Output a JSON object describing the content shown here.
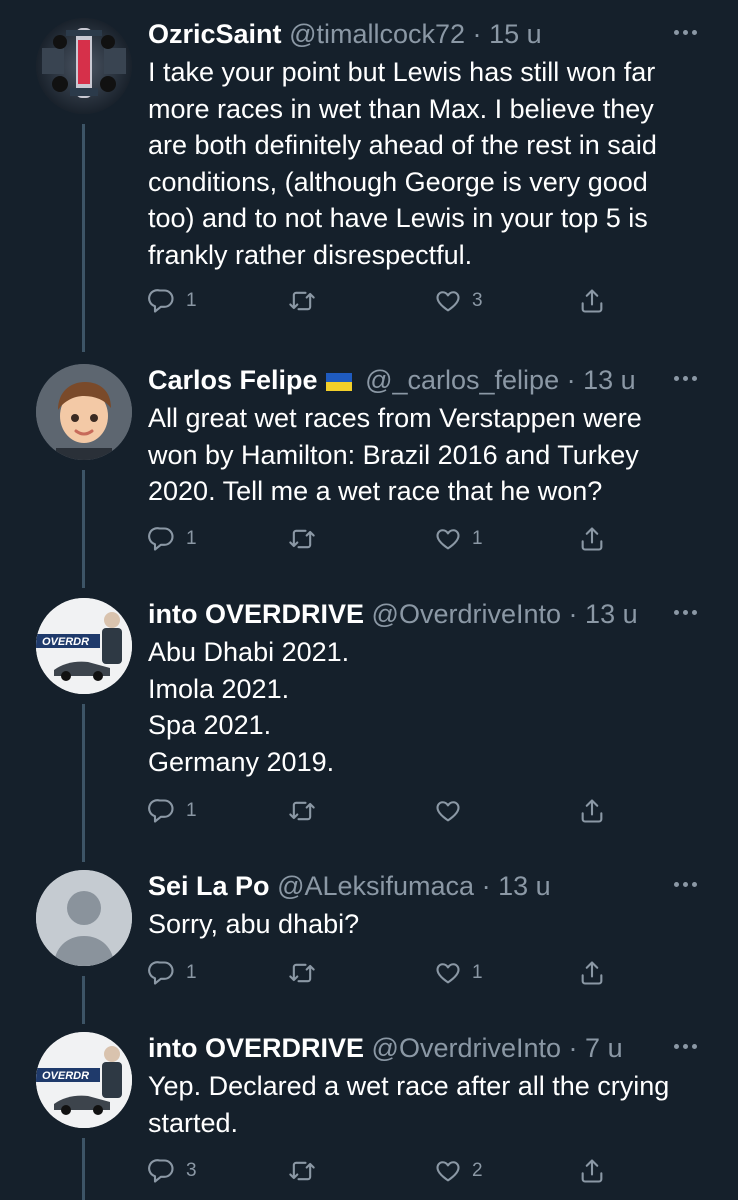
{
  "tweets": [
    {
      "name": "OzricSaint",
      "handle": "@timallcock72",
      "separator": "·",
      "time": "15 u",
      "lines": [
        "I take your point but Lewis has still won far",
        "more races in wet than Max. I believe they",
        "are both definitely ahead of the rest in said",
        "conditions, (although George is very good",
        "too) and to not have Lewis in your top 5 is",
        "frankly rather disrespectful."
      ],
      "replies": "1",
      "retweets": "",
      "likes": "3"
    },
    {
      "name": "Carlos Felipe",
      "handle": "@_carlos_felipe",
      "separator": "·",
      "time": "13 u",
      "lines": [
        "All great wet races from Verstappen were",
        "won by Hamilton: Brazil 2016 and Turkey",
        "2020. Tell me a wet race that he won?"
      ],
      "replies": "1",
      "retweets": "",
      "likes": "1"
    },
    {
      "name": "into OVERDRIVE",
      "handle": "@OverdriveInto",
      "separator": "·",
      "time": "13 u",
      "avatar_text": "OVERDR",
      "lines": [
        "Abu Dhabi 2021.",
        "Imola 2021.",
        "Spa 2021.",
        "Germany 2019."
      ],
      "replies": "1",
      "retweets": "",
      "likes": ""
    },
    {
      "name": "Sei La Po",
      "handle": "@ALeksifumaca",
      "separator": "·",
      "time": "13 u",
      "lines": [
        "Sorry, abu dhabi?"
      ],
      "replies": "1",
      "retweets": "",
      "likes": "1"
    },
    {
      "name": "into OVERDRIVE",
      "handle": "@OverdriveInto",
      "separator": "·",
      "time": "7 u",
      "avatar_text": "OVERDR",
      "lines": [
        "Yep. Declared a wet race after all the crying",
        "started."
      ],
      "replies": "3",
      "retweets": "",
      "likes": "2"
    }
  ],
  "colors": {
    "background": "#15202b",
    "text": "#ffffff",
    "secondary": "#8b98a5",
    "thread_line": "#3d5466"
  },
  "icons": [
    "reply-icon",
    "retweet-icon",
    "like-icon",
    "share-icon",
    "more-icon",
    "ukraine-flag-icon"
  ]
}
